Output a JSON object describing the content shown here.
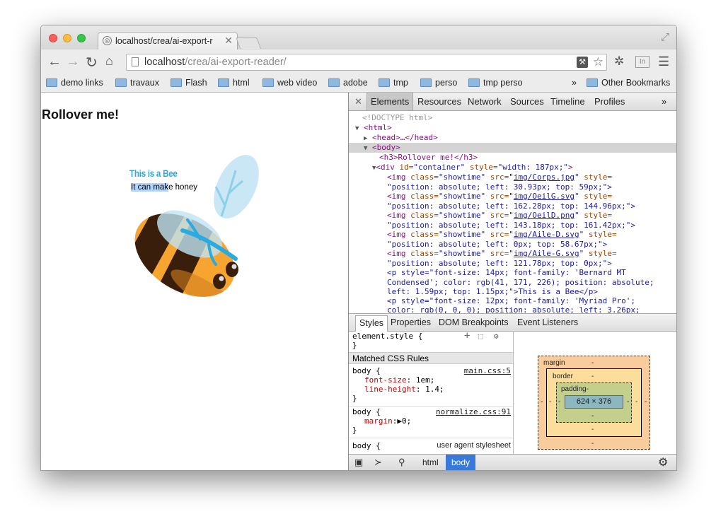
{
  "browser": {
    "tab_title": "localhost/crea/ai-export-r",
    "url_host": "localhost",
    "url_path": "/crea/ai-export-reader/",
    "bookmarks": [
      "demo links",
      "travaux",
      "Flash",
      "html",
      "web video",
      "adobe",
      "tmp",
      "perso",
      "tmp perso"
    ],
    "bookmarks_overflow": "»",
    "other_bookmarks": "Other Bookmarks",
    "ext_badge": "In",
    "colors": {
      "close": "#fc605c",
      "minimize": "#fdbc40",
      "zoom": "#34c84a"
    }
  },
  "page": {
    "heading": "Rollover me!",
    "bee_title": "This is a Bee",
    "bee_subtitle_highlight": "It can mak",
    "bee_subtitle_rest": "e honey",
    "colors": {
      "bee_title": "#29abe2",
      "bee_body": "#f7a531",
      "bee_stripe": "#3a1e0c",
      "wing": "#bfe3f2",
      "wing_vein": "#29abe2"
    }
  },
  "devtools": {
    "close_glyph": "✕",
    "tabs": [
      "Elements",
      "Resources",
      "Network",
      "Sources",
      "Timeline",
      "Profiles"
    ],
    "tabs_overflow": "»",
    "dom": {
      "doctype": "<!DOCTYPE html>",
      "html_open": "<html>",
      "head": "<head>…</head>",
      "body_open": "<body>",
      "h3": "<h3>Rollover me!</h3>",
      "div_open": "<div",
      "div_attr1": "id=",
      "div_val1": "\"container\"",
      "div_attr2": "style=",
      "div_val2": "\"width: 187px;\"",
      "div_close": ">",
      "img_open": "<img",
      "class_attr": "class=",
      "class_val": "\"showtime\"",
      "src_attr": "src=",
      "style_attr": "style=",
      "imgs": [
        {
          "src": "img/Corps.jpg",
          "style": "\"position: absolute; left: 30.93px; top: 59px;\">"
        },
        {
          "src": "img/OeilG.svg",
          "style": "\"position: absolute; left: 162.28px; top: 144.96px;\">"
        },
        {
          "src": "img/OeilD.png",
          "style": "\"position: absolute; left: 143.18px; top: 161.42px;\">"
        },
        {
          "src": "img/Aile-D.svg",
          "style": "\"position: absolute; left: 0px; top: 58.67px;\">"
        },
        {
          "src": "img/Aile-G.svg",
          "style": "\"position: absolute; left: 121.78px; top: 0px;\">"
        }
      ],
      "p1_line1": "<p style=\"font-size: 14px; font-family: 'Bernard MT",
      "p1_line2": "Condensed'; color: rgb(41, 171, 226); position: absolute;",
      "p1_line3": "left: 1.59px; top: 1.15px;\">This is a Bee</p>",
      "p2_line1": "<p style=\"font-size: 12px; font-family: 'Myriad Pro';",
      "p2_line2": "color: rgb(0, 0, 0); position: absolute; left: 3.26px;"
    },
    "styles_tabs": [
      "Styles",
      "Properties",
      "DOM Breakpoints",
      "Event Listeners"
    ],
    "styles": {
      "element_style": "element.style {",
      "close_brace": "}",
      "matched_header": "Matched CSS Rules",
      "rule1_selector": "body {",
      "rule1_source": "main.css:5",
      "rule1_prop1": "font-size",
      "rule1_val1": ": 1em;",
      "rule1_prop2": "line-height",
      "rule1_val2": ": 1.4;",
      "rule2_selector": "body {",
      "rule2_source": "normalize.css:91",
      "rule2_prop": "margin",
      "rule2_val": ":▶0;",
      "rule3_selector": "body {",
      "rule3_source": "user agent stylesheet"
    },
    "box_model": {
      "margin_label": "margin",
      "border_label": "border",
      "padding_label": "padding",
      "dash": "-",
      "content_size": "624 × 376"
    },
    "breadcrumbs": [
      "html",
      "body"
    ]
  }
}
